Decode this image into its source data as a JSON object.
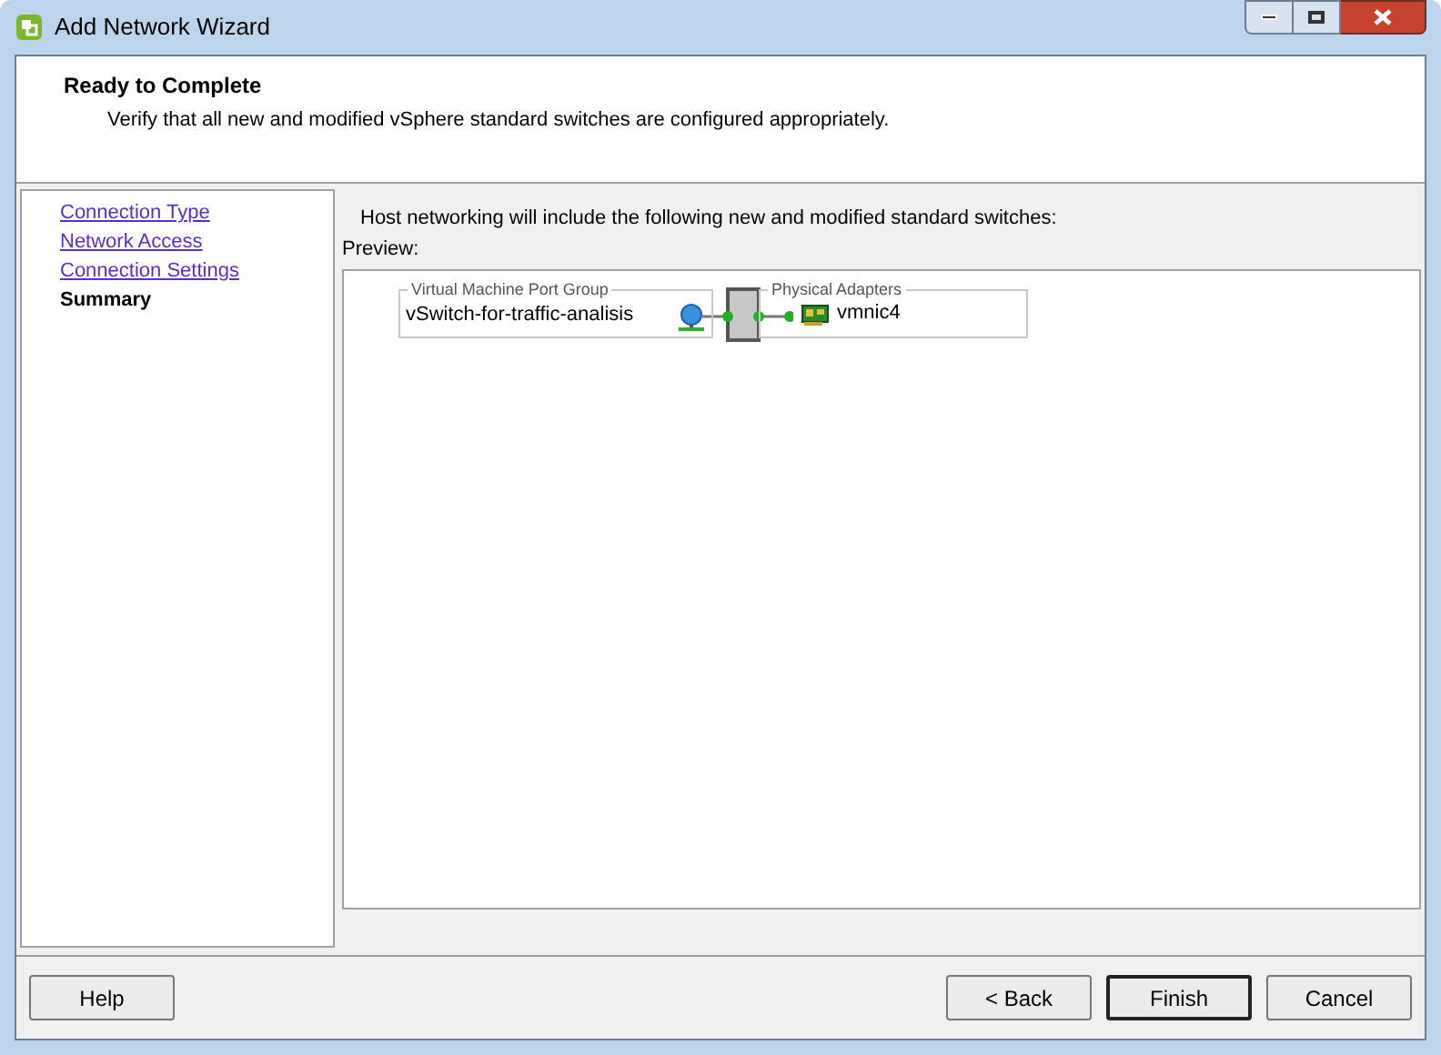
{
  "window": {
    "title": "Add Network Wizard"
  },
  "header": {
    "title": "Ready to Complete",
    "subtitle": "Verify that all new and modified vSphere standard switches are configured appropriately."
  },
  "steps": [
    {
      "label": "Connection Type",
      "selected": false
    },
    {
      "label": "Network Access",
      "selected": false
    },
    {
      "label": "Connection Settings",
      "selected": false
    },
    {
      "label": "Summary",
      "selected": true
    }
  ],
  "intro": "Host networking will include the following new and modified standard switches:",
  "preview": {
    "label": "Preview:",
    "port_group": {
      "legend": "Virtual Machine Port Group",
      "name": "vSwitch-for-traffic-analisis"
    },
    "adapters": {
      "legend": "Physical Adapters",
      "name": "vmnic4"
    }
  },
  "buttons": [
    {
      "label": "Help",
      "kind": "help"
    },
    {
      "label": "< Back",
      "kind": "nav"
    },
    {
      "label": "Finish",
      "kind": "default"
    },
    {
      "label": "Cancel",
      "kind": "nav"
    }
  ]
}
